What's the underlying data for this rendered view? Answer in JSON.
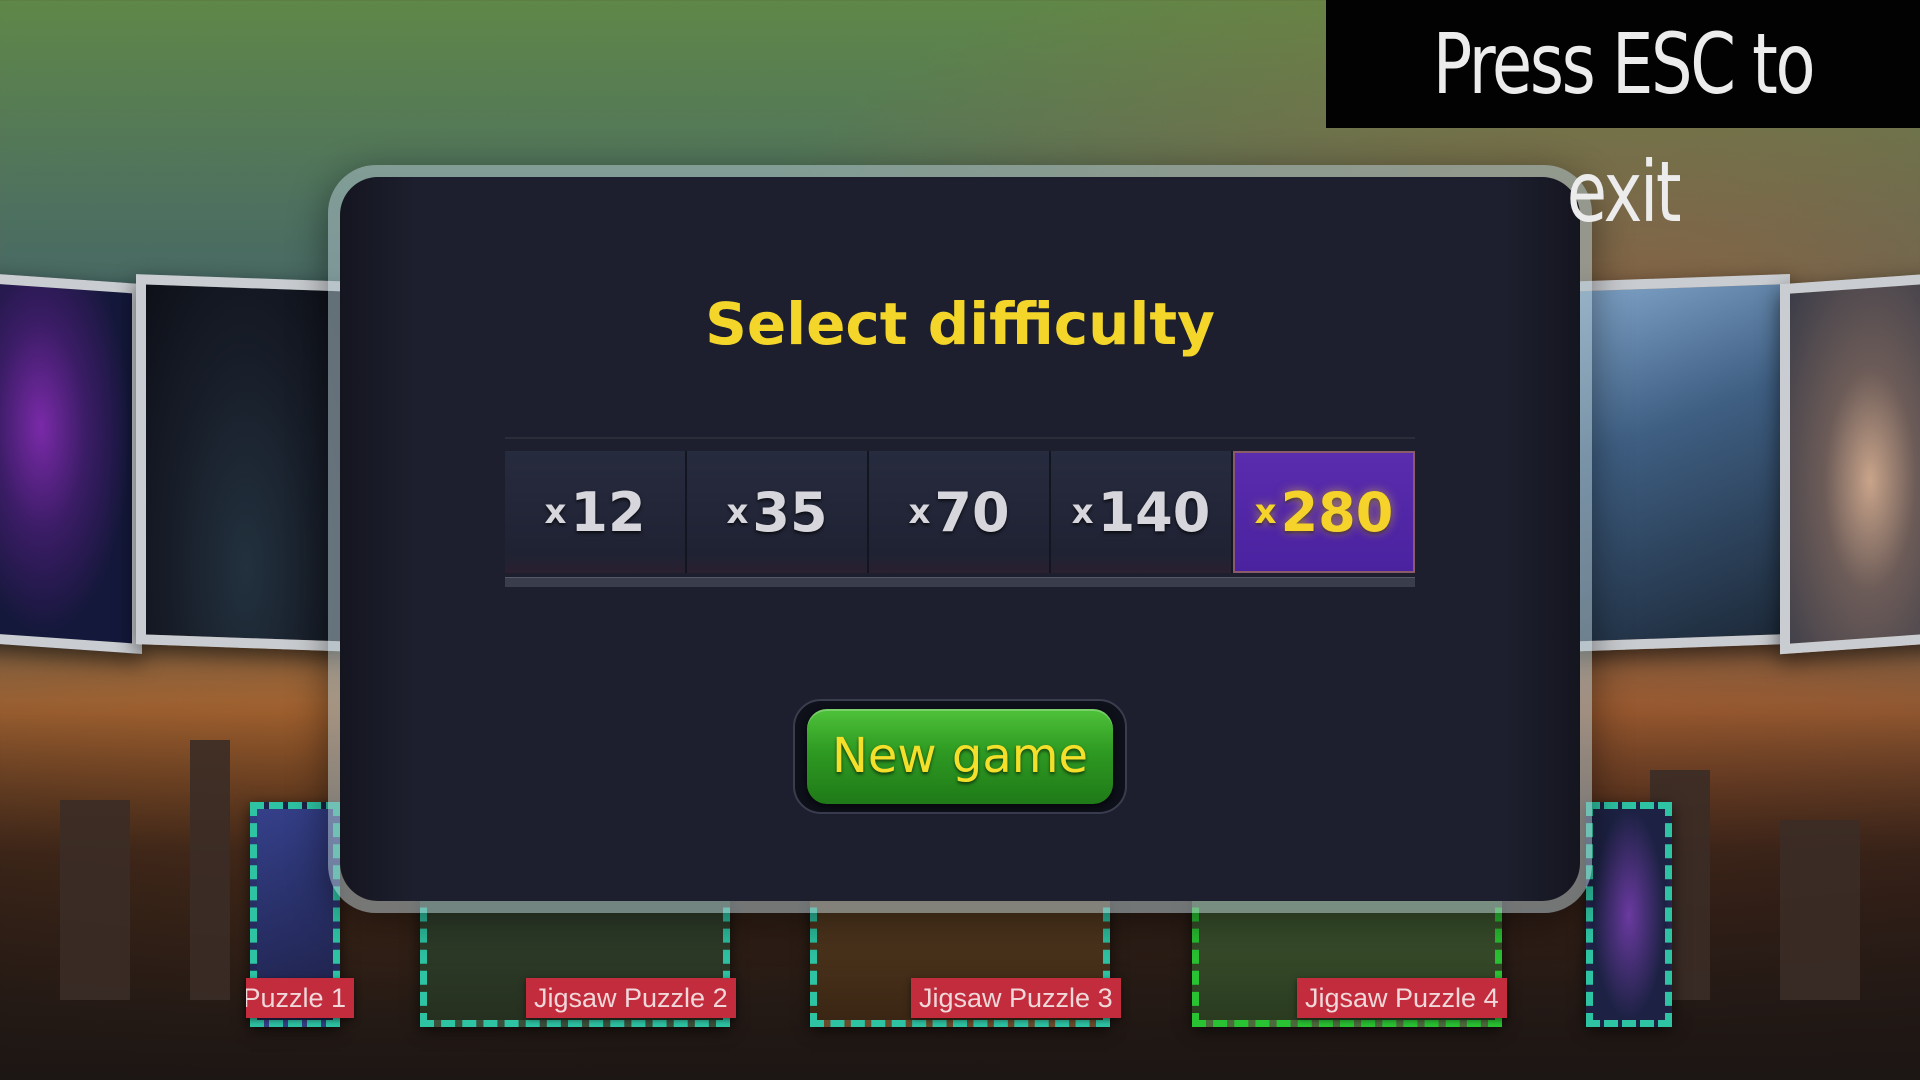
{
  "esc_hint": "Press ESC to exit",
  "dialog": {
    "title": "Select difficulty",
    "prefix": "x",
    "options": [
      "12",
      "35",
      "70",
      "140",
      "280"
    ],
    "selected": "280",
    "new_game_label": "New game"
  },
  "puzzles": [
    {
      "label": "Puzzle 1"
    },
    {
      "label": "Jigsaw Puzzle 2"
    },
    {
      "label": "Jigsaw Puzzle 3"
    },
    {
      "label": "Jigsaw Puzzle 4"
    }
  ],
  "colors": {
    "title": "#f4d62a",
    "selected_option": "#4a22a0",
    "new_game": "#2e9a22",
    "thumb_border": "#2ec3a3",
    "thumb_active_border": "#29c232",
    "label_bg": "#c22c3c"
  }
}
